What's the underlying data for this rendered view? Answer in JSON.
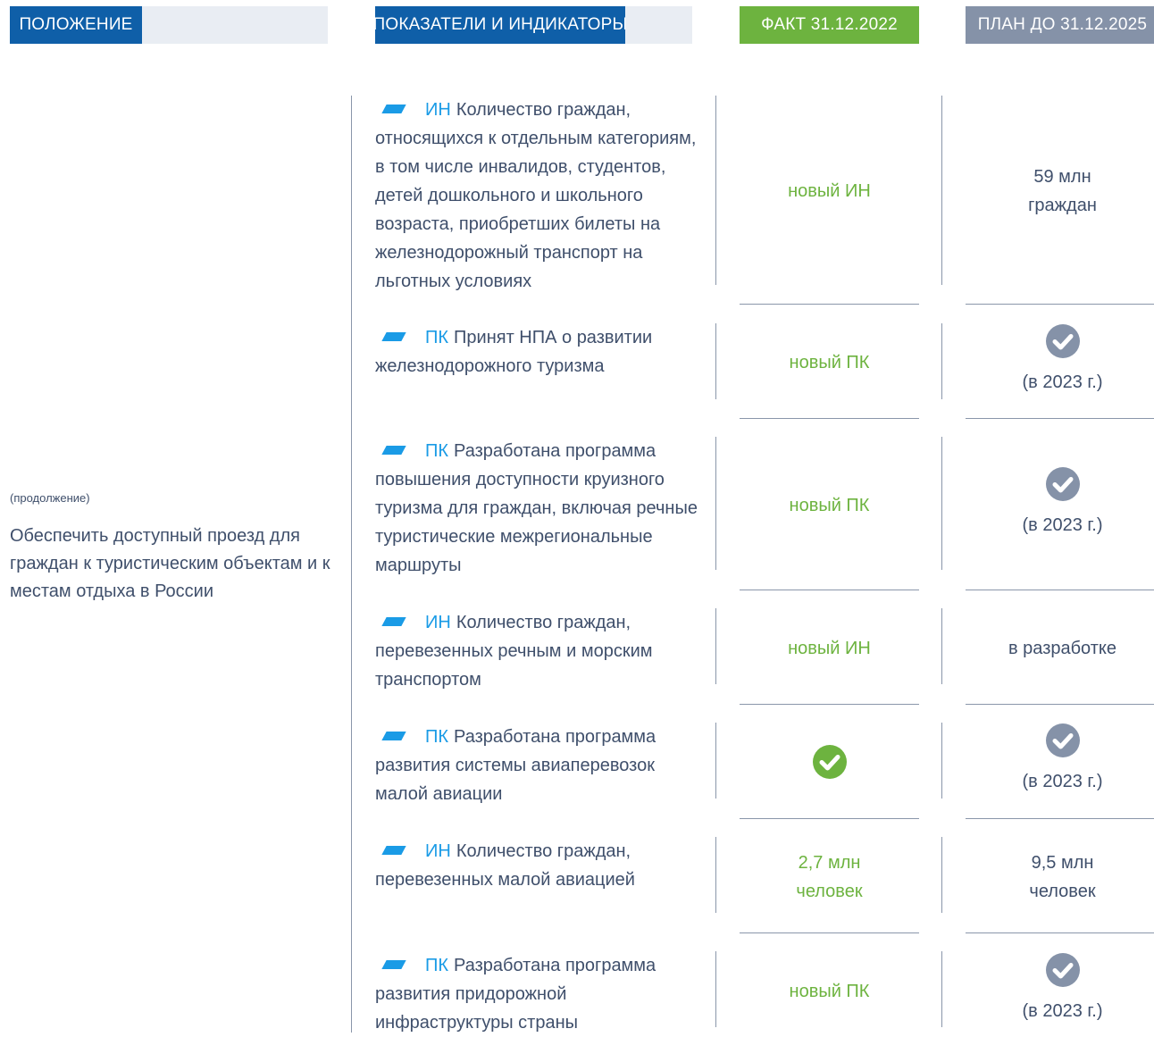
{
  "headers": {
    "position": "ПОЛОЖЕНИЕ",
    "indicators": "ПОКАЗАТЕЛИ И ИНДИКАТОРЫ",
    "fact": "ФАКТ 31.12.2022",
    "plan": "ПЛАН ДО 31.12.2025"
  },
  "colors": {
    "header_blue": "#0f5fa8",
    "header_green": "#6db33f",
    "header_gray": "#8592a8",
    "accent_blue": "#1a9be6",
    "fact_green": "#6db33f",
    "text": "#3f4f6b"
  },
  "position": {
    "note": "(продолжение)",
    "text": "Обеспечить доступный проезд для граждан к туристическим объектам и к местам отдыха в России"
  },
  "rows": [
    {
      "code": "ИН",
      "text": "Количество граждан, относящихся к отдельным категориям, в том числе инвалидов, студентов, детей дошкольного и школьного возраста, приобретших билеты на железнодорожный транспорт на льготных условиях",
      "fact": "новый ИН",
      "fact_check": false,
      "plan": "59 млн граждан",
      "plan_check": false
    },
    {
      "code": "ПК",
      "text": "Принят НПА о развитии железнодорожного туризма",
      "fact": "новый ПК",
      "fact_check": false,
      "plan": "(в 2023 г.)",
      "plan_check": true
    },
    {
      "code": "ПК",
      "text": "Разработана программа повышения доступности круизного туризма для граждан, включая речные туристические межрегиональные маршруты",
      "fact": "новый ПК",
      "fact_check": false,
      "plan": "(в 2023 г.)",
      "plan_check": true
    },
    {
      "code": "ИН",
      "text": "Количество граждан, перевезенных речным и морским транспортом",
      "fact": "новый ИН",
      "fact_check": false,
      "plan": "в разработке",
      "plan_check": false
    },
    {
      "code": "ПК",
      "text": "Разработана программа развития системы авиаперевозок малой авиации",
      "fact": "",
      "fact_check": true,
      "plan": "(в 2023 г.)",
      "plan_check": true
    },
    {
      "code": "ИН",
      "text": "Количество граждан, перевезенных малой авиацией",
      "fact": "2,7 млн человек",
      "fact_check": false,
      "plan": "9,5 млн человек",
      "plan_check": false
    },
    {
      "code": "ПК",
      "text": "Разработана программа развития придорожной инфраструктуры страны",
      "fact": "новый ПК",
      "fact_check": false,
      "plan": "(в 2023 г.)",
      "plan_check": true
    }
  ]
}
